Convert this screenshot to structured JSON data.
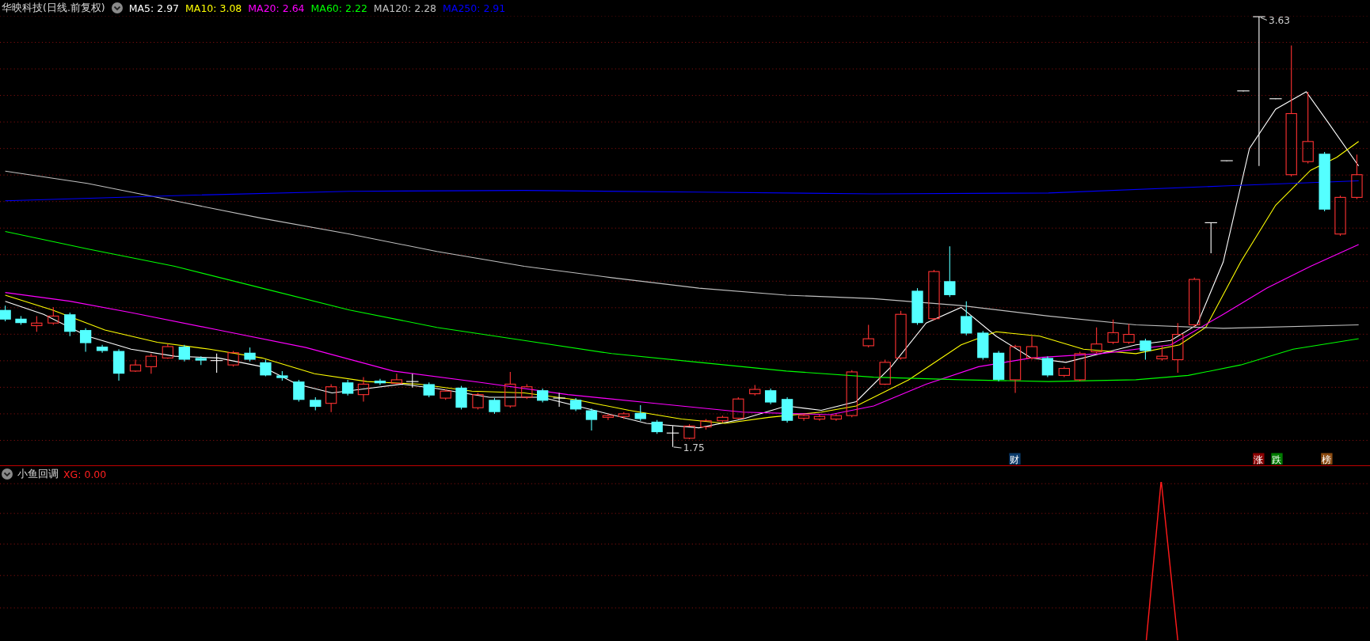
{
  "header": {
    "title": "华映科技(日线.前复权)",
    "indicators": [
      {
        "label": "MA5: 2.97",
        "color": "#ffffff"
      },
      {
        "label": "MA10: 3.08",
        "color": "#ffff00"
      },
      {
        "label": "MA20: 2.64",
        "color": "#ff00ff"
      },
      {
        "label": "MA60: 2.22",
        "color": "#00ff00"
      },
      {
        "label": "MA120: 2.28",
        "color": "#c0c0c0"
      },
      {
        "label": "MA250: 2.91",
        "color": "#0000ff"
      }
    ]
  },
  "price_chart": {
    "high_label": "3.63",
    "low_label": "1.75",
    "event_tags": [
      {
        "label": "财",
        "color": "#0a3a6a"
      },
      {
        "label": "涨",
        "color": "#8a0000"
      },
      {
        "label": "跌",
        "color": "#007a00"
      },
      {
        "label": "榜",
        "color": "#8a4a10"
      }
    ]
  },
  "indicator_panel": {
    "title": "小鱼回调",
    "reading": "XG: 0.00"
  }
}
